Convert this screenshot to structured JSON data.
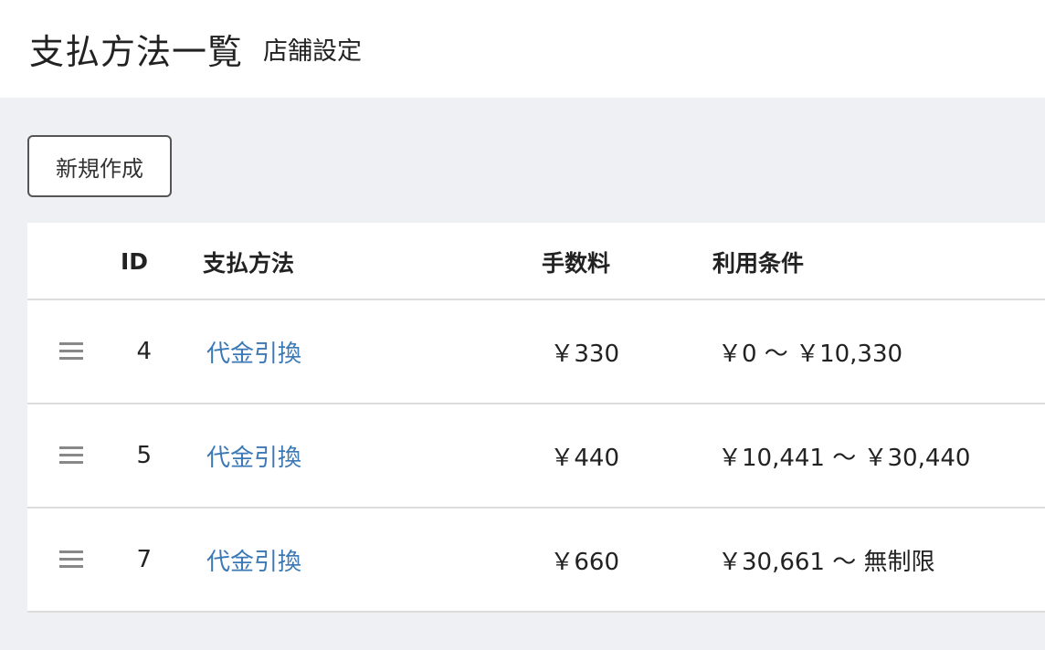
{
  "header": {
    "title": "支払方法一覧",
    "subtitle": "店舗設定"
  },
  "toolbar": {
    "new_label": "新規作成"
  },
  "table": {
    "columns": {
      "id": "ID",
      "method": "支払方法",
      "fee": "手数料",
      "condition": "利用条件"
    },
    "rows": [
      {
        "id": "4",
        "method": "代金引換",
        "fee": "￥330",
        "condition": "￥0 〜 ￥10,330"
      },
      {
        "id": "5",
        "method": "代金引換",
        "fee": "￥440",
        "condition": "￥10,441 〜 ￥30,440"
      },
      {
        "id": "7",
        "method": "代金引換",
        "fee": "￥660",
        "condition": "￥30,661 〜 無制限"
      }
    ]
  },
  "icons": {
    "drag_handle": "hamburger-drag-handle-icon"
  },
  "colors": {
    "link": "#3b78b6",
    "background": "#eef0f4",
    "panel": "#ffffff"
  }
}
